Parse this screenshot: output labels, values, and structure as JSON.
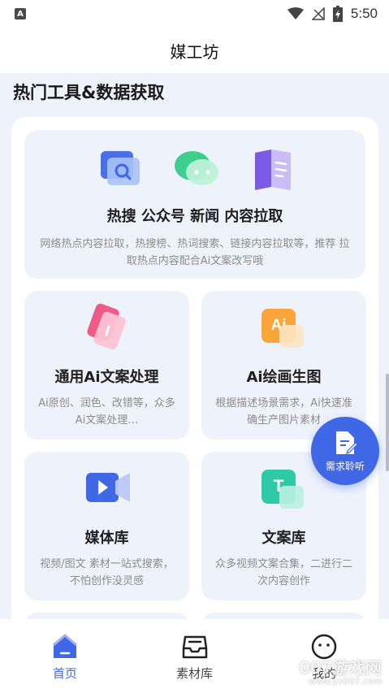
{
  "status_bar": {
    "time": "5:50",
    "icons": [
      "app-a-icon",
      "wifi-icon",
      "no-signal-icon",
      "battery-charging-icon"
    ]
  },
  "header": {
    "title": "媒工坊"
  },
  "section": {
    "title": "热门工具&数据获取"
  },
  "cards": {
    "content_fetch": {
      "title": "热搜 公众号 新闻 内容拉取",
      "desc": "网络热点内容拉取，热搜榜、热词搜索、链接内容拉取等，推荐 拉取热点内容配合Ai文案改写哦",
      "icons": [
        "search-icon",
        "wechat-icon",
        "news-book-icon"
      ]
    },
    "ai_writing": {
      "title": "通用Ai文案处理",
      "desc": "Ai原创、润色、改错等，众多Ai文案处理…",
      "icon": "document-cards-icon"
    },
    "ai_drawing": {
      "title": "Ai绘画生图",
      "desc": "根据描述场景需求，Ai快速准确生产图片素材",
      "icon": "ai-image-icon",
      "icon_text": "Ai"
    },
    "media_library": {
      "title": "媒体库",
      "desc": "视频/图文 素材一站式搜索，不怕创作没灵感",
      "icon": "video-camera-icon"
    },
    "copy_library": {
      "title": "文案库",
      "desc": "众多视频文案合集，二进行二次内容创作",
      "icon": "text-template-icon",
      "icon_text": "T"
    }
  },
  "fab": {
    "label": "需求聆听",
    "icon": "edit-document-icon"
  },
  "bottom_nav": {
    "items": [
      {
        "label": "首页",
        "icon": "home-icon",
        "active": true
      },
      {
        "label": "素材库",
        "icon": "inbox-tray-icon",
        "active": false
      },
      {
        "label": "我的",
        "icon": "smiley-face-icon",
        "active": false
      }
    ]
  },
  "watermark": {
    "text": "007游戏网",
    "url": "www.yx007.com"
  },
  "colors": {
    "accent": "#3f67e6",
    "card_bg": "#eef2fb",
    "page_bg": "#eef2fb"
  }
}
